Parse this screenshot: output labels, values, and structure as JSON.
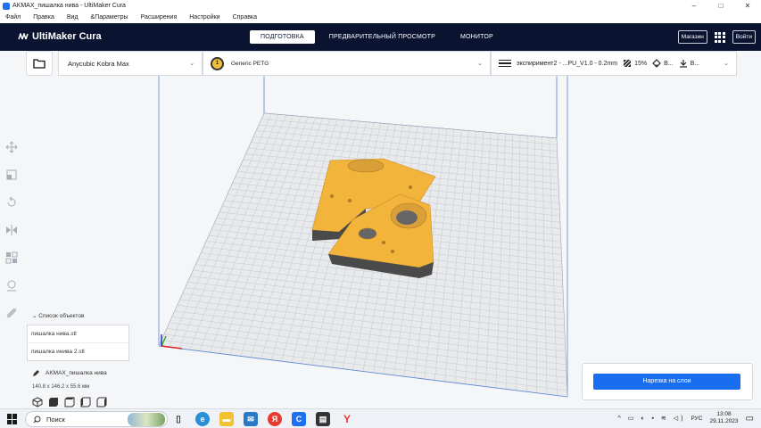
{
  "window": {
    "title": "AKMAX_пишалка нива - UltiMaker Cura",
    "minimize": "–",
    "maximize": "□",
    "close": "✕"
  },
  "menu": [
    "Файл",
    "Правка",
    "Вид",
    "&Параметры",
    "Расширения",
    "Настройки",
    "Справка"
  ],
  "header": {
    "logo": "UltiMaker Cura",
    "tabs": [
      "ПОДГОТОВКА",
      "ПРЕДВАРИТЕЛЬНЫЙ ПРОСМОТР",
      "МОНИТОР"
    ],
    "active_tab": "ПОДГОТОВКА",
    "marketplace": "Магазин",
    "signin": "Войти"
  },
  "toolbar": {
    "printer": "Anycubic Kobra Max",
    "material_index": "1",
    "material": "Generic PETG",
    "profile": "экспиримент2 - ...PU_V1.0 - 0.2mm",
    "infill": "15%",
    "support_short": "B...",
    "adhesion_short": "B..."
  },
  "objects": {
    "header": "Список объектов",
    "items": [
      "пишалка нива.stl",
      "пишалка инива 2.stl"
    ],
    "project_name": "AKMAX_пишалка нива",
    "dimensions": "140.8 x 146.2 x 55.6 мм"
  },
  "slice": {
    "button": "Нарезка на слои"
  },
  "taskbar": {
    "search": "Поиск",
    "lang": "РУС",
    "time": "13:08",
    "date": "29.11.2023"
  },
  "colors": {
    "header_bg": "#0a1431",
    "accent": "#196ef0",
    "model": "#f2b43a",
    "buildplate": "#e9eaec"
  }
}
